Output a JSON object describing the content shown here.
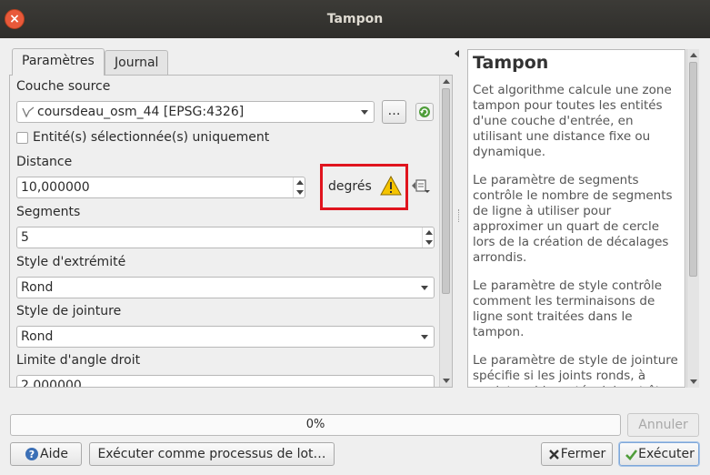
{
  "window": {
    "title": "Tampon",
    "close_glyph": "×"
  },
  "tabs": [
    {
      "label": "Paramètres",
      "active": true
    },
    {
      "label": "Journal",
      "active": false
    }
  ],
  "params": {
    "source_layer_label": "Couche source",
    "source_layer_value": "coursdeau_osm_44 [EPSG:4326]",
    "browse_label": "…",
    "selected_only_label": "Entité(s) sélectionnée(s) uniquement",
    "distance_label": "Distance",
    "distance_value": "10,000000",
    "distance_unit": "degrés",
    "segments_label": "Segments",
    "segments_value": "5",
    "end_cap_label": "Style d'extrémité",
    "end_cap_value": "Rond",
    "join_label": "Style de jointure",
    "join_value": "Rond",
    "miter_label": "Limite d'angle droit",
    "miter_value": "2,000000"
  },
  "help": {
    "title": "Tampon",
    "paragraphs": [
      "Cet algorithme calcule une zone tampon pour toutes les entités d'une couche d'entrée, en utilisant une distance fixe ou dynamique.",
      "Le paramètre de segments contrôle le nombre de segments de ligne à utiliser pour approximer un quart de cercle lors de la création de décalages arrondis.",
      "Le paramètre de style contrôle comment les terminaisons de ligne sont traitées dans le tampon.",
      "Le paramètre de style de jointure spécifie si les joints ronds, à onglet ou biseautés doivent être utilisés lors du décalage des coins d'une ligne."
    ]
  },
  "progress": {
    "label": "0%",
    "value": 0
  },
  "buttons": {
    "cancel": "Annuler",
    "help": "Aide",
    "batch": "Exécuter comme processus de lot…",
    "close": "Fermer",
    "run": "Exécuter"
  },
  "colors": {
    "highlight": "#e0141e",
    "warning": "#f5c400"
  }
}
